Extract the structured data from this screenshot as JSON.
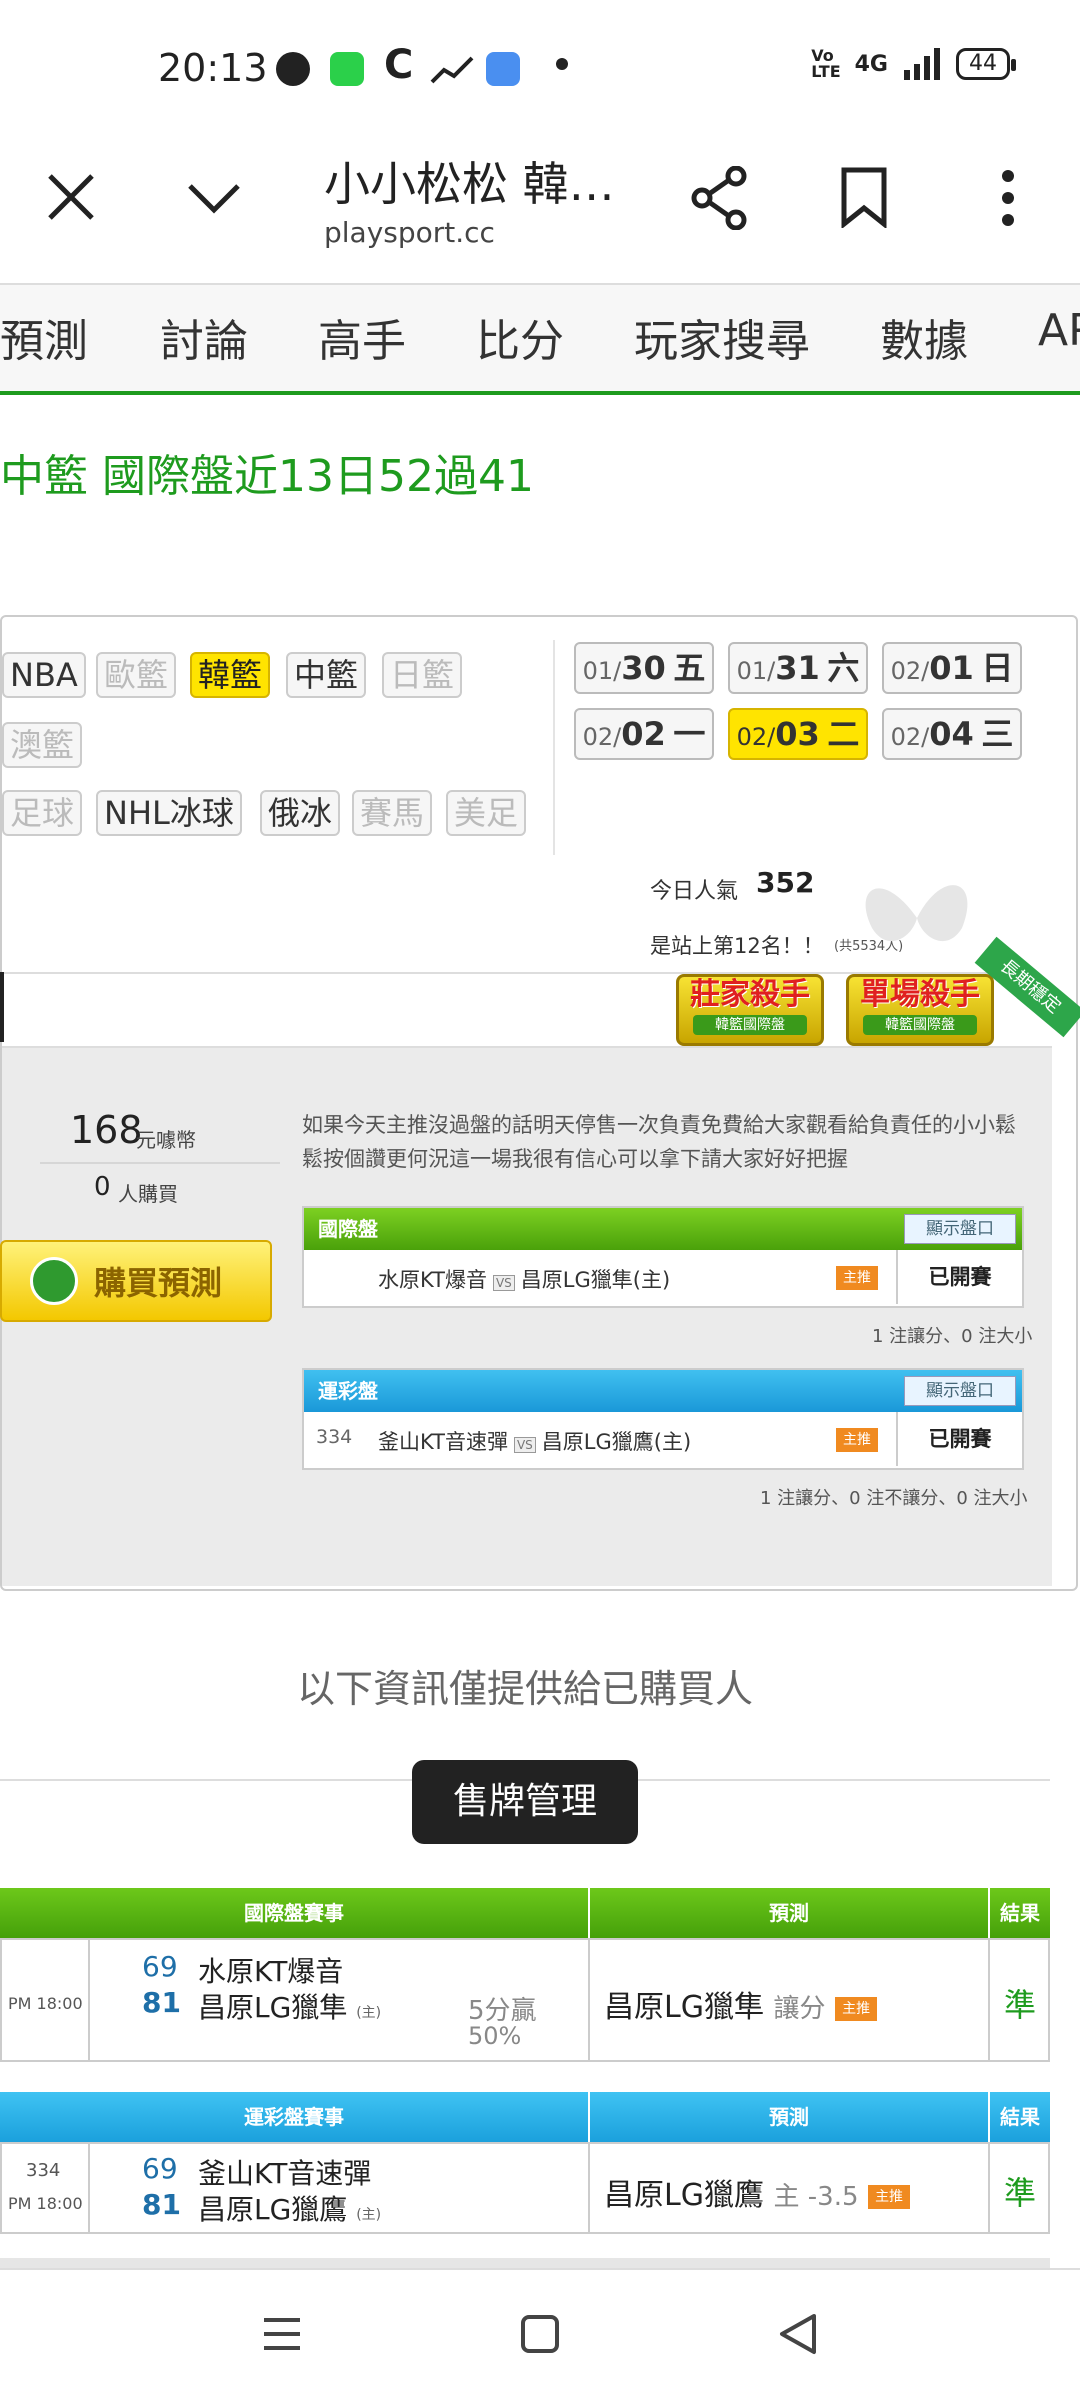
{
  "status": {
    "time": "20:13",
    "network": "4G",
    "battery": "44"
  },
  "topbar": {
    "title": "小小松松 韓…",
    "url": "playsport.cc"
  },
  "nav": {
    "items": [
      "預測",
      "討論",
      "高手",
      "比分",
      "玩家搜尋",
      "數據",
      "AP"
    ]
  },
  "headline": "中籃 國際盤近13日52過41",
  "leagues": {
    "row1": [
      "NBA",
      "歐籃",
      "韓籃",
      "中籃",
      "日籃"
    ],
    "row2": [
      "澳籃"
    ],
    "row3": [
      "足球",
      "NHL冰球",
      "俄冰",
      "賽馬",
      "美足"
    ]
  },
  "dates": [
    {
      "month": "01/",
      "day": "30",
      "dow": "五"
    },
    {
      "month": "01/",
      "day": "31",
      "dow": "六"
    },
    {
      "month": "02/",
      "day": "01",
      "dow": "日"
    },
    {
      "month": "02/",
      "day": "02",
      "dow": "一"
    },
    {
      "month": "02/",
      "day": "03",
      "dow": "二"
    },
    {
      "month": "02/",
      "day": "04",
      "dow": "三"
    }
  ],
  "popularity": {
    "label": "今日人氣",
    "value": "352",
    "rank_text": "是站上第12名！！",
    "rank_total": "(共5534人)"
  },
  "badges": {
    "banker": "莊家殺手",
    "banker_sub": "韓籃國際盤",
    "single": "單場殺手",
    "single_sub": "韓籃國際盤",
    "ribbon": "長期穩定"
  },
  "purchase": {
    "coins": "168",
    "coin_unit": "元噱幣",
    "buyers": "0",
    "buyers_unit": "人購買",
    "button": "購買預測"
  },
  "description": "如果今天主推沒過盤的話明天停售一次負責免費給大家觀看給負責任的小小鬆鬆按個讚更何況這一場我很有信心可以拿下請大家好好把握",
  "intl_box": {
    "title": "國際盤",
    "show_btn": "顯示盤口",
    "away": "水原KT爆音",
    "vs": "VS",
    "home": "昌原LG獵隼(主)",
    "main_tag": "主推",
    "status": "已開賽",
    "note": "1 注讓分、0 注大小"
  },
  "lottery_box": {
    "title": "運彩盤",
    "show_btn": "顯示盤口",
    "number": "334",
    "away": "釜山KT音速彈",
    "vs": "VS",
    "home": "昌原LG獵鷹(主)",
    "main_tag": "主推",
    "status": "已開賽",
    "note": "1 注讓分、0 注不讓分、0 注大小"
  },
  "info_note": "以下資訊僅提供給已購買人",
  "manage_button": "售牌管理",
  "intl_table": {
    "headers": [
      "國際盤賽事",
      "預測",
      "結果"
    ],
    "time": "PM 18:00",
    "away_score": "69",
    "away_team": "水原KT爆音",
    "home_score": "81",
    "home_team": "昌原LG獵隼",
    "host_mark": "(主)",
    "handicap": "5分贏",
    "handicap_pct": "50%",
    "pred_team": "昌原LG獵隼",
    "pred_type": "讓分",
    "pred_tag": "主推",
    "result": "準"
  },
  "lottery_table": {
    "headers": [
      "運彩盤賽事",
      "預測",
      "結果"
    ],
    "number": "334",
    "time": "PM 18:00",
    "away_score": "69",
    "away_team": "釜山KT音速彈",
    "home_score": "81",
    "home_team": "昌原LG獵鷹",
    "host_mark": "(主)",
    "pred_team": "昌原LG獵鷹",
    "pred_type": "主 -3.5",
    "pred_tag": "主推",
    "result": "準"
  },
  "colors": {
    "accent_green": "#1e9b1e",
    "highlight_yellow": "#ffe400",
    "lottery_blue": "#1a98d8"
  }
}
